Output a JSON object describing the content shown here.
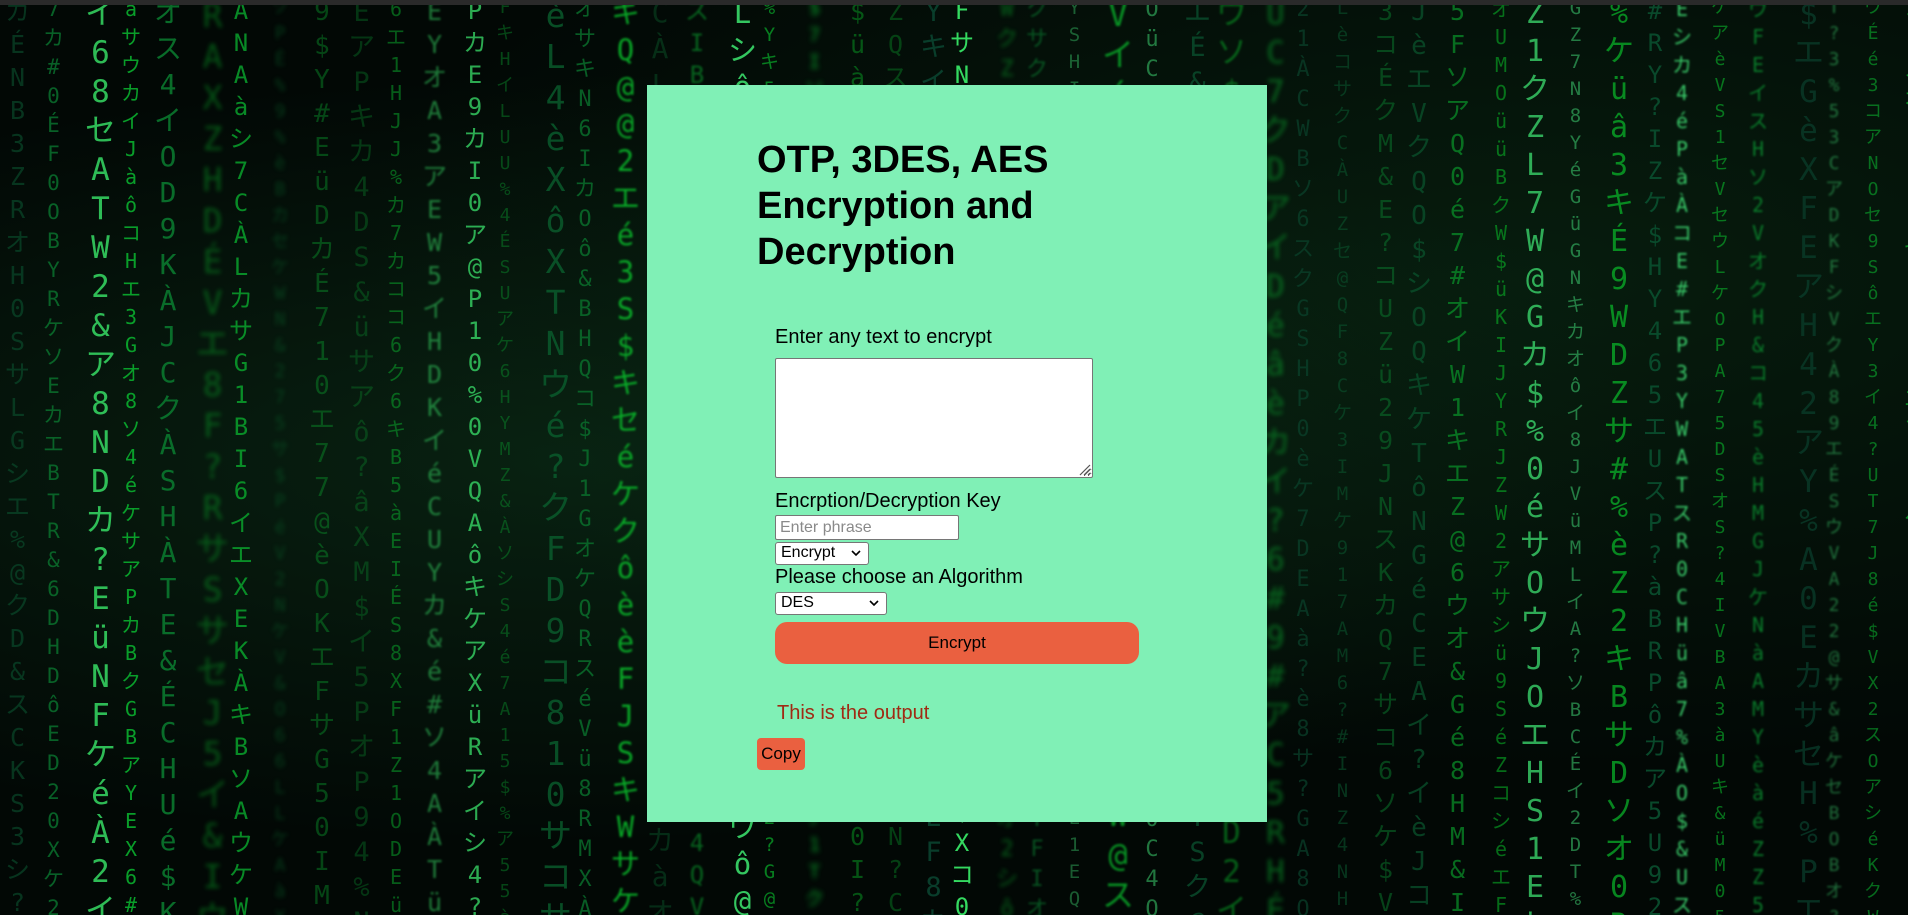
{
  "app": {
    "title": "OTP, 3DES, AES Encryption and Decryption"
  },
  "form": {
    "text_label": "Enter any text to encrypt",
    "text_value": "",
    "key_label": "Encrption/Decryption Key",
    "key_value": "",
    "key_placeholder": "Enter phrase",
    "mode_selected": "Encrypt",
    "algorithm_label": "Please choose an Algorithm",
    "algorithm_selected": "DES",
    "submit_label": "Encrypt"
  },
  "result": {
    "output_text": "This is the output",
    "copy_label": "Copy"
  },
  "colors": {
    "card_background": "#80f0b6",
    "button_accent": "#ea6040",
    "output_text": "#a02a14",
    "matrix_green": "#1aa84a"
  },
  "icons": {
    "select_arrow": "chevron-down-icon",
    "textarea_resize": "resize-grip-icon"
  }
}
